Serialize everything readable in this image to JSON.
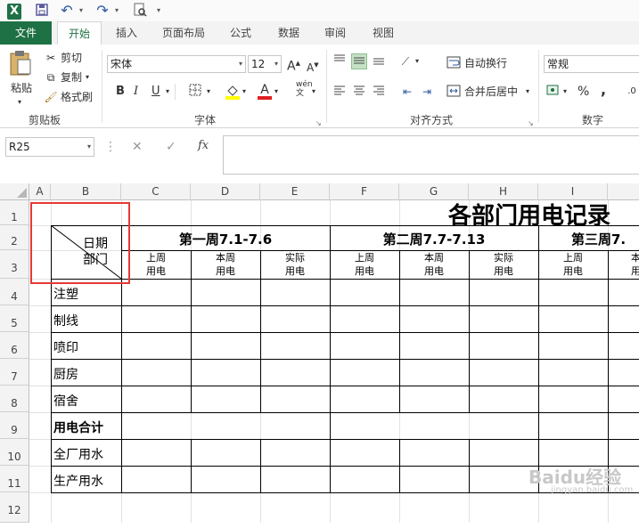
{
  "qat": {
    "logo": "X",
    "save_icon": "save-icon",
    "undo_icon": "undo-icon",
    "redo_icon": "redo-icon",
    "preview_icon": "print-preview-icon",
    "customize": "▾"
  },
  "tabs": [
    "文件",
    "开始",
    "插入",
    "页面布局",
    "公式",
    "数据",
    "审阅",
    "视图"
  ],
  "ribbon": {
    "clipboard": {
      "paste": "粘贴",
      "cut": "剪切",
      "copy": "复制",
      "format_painter": "格式刷",
      "label": "剪贴板"
    },
    "font": {
      "name": "宋体",
      "size": "12",
      "grow": "A",
      "shrink": "A",
      "bold": "B",
      "italic": "I",
      "underline": "U",
      "wen": "wén",
      "label": "字体"
    },
    "alignment": {
      "wrap": "自动换行",
      "merge": "合并后居中",
      "label": "对齐方式"
    },
    "number": {
      "format": "常规",
      "percent": "%",
      "comma": ",",
      "label": "数字"
    }
  },
  "formula_bar": {
    "name_box": "R25",
    "fx": "fx",
    "cancel": "✕",
    "enter": "✓",
    "value": ""
  },
  "columns": [
    "A",
    "B",
    "C",
    "D",
    "E",
    "F",
    "G",
    "H",
    "I"
  ],
  "rows": [
    "1",
    "2",
    "3",
    "4",
    "5",
    "6",
    "7",
    "8",
    "9",
    "10",
    "11",
    "12"
  ],
  "sheet": {
    "title": "各部门用电记录",
    "diag_top": "日期",
    "diag_bottom": "部门",
    "week1": "第一周7.1-7.6",
    "week2": "第二周7.7-7.13",
    "week3": "第三周7.",
    "sub_c": "上周\n用电",
    "sub_d": "本周\n用电",
    "sub_e": "实际\n用电",
    "sub_f": "上周\n用电",
    "sub_g": "本周\n用电",
    "sub_h": "实际\n用电",
    "sub_i": "上周\n用电",
    "sub_j": "本",
    "sub_j2": "用",
    "dept": [
      "注塑",
      "制线",
      "喷印",
      "厨房",
      "宿舍"
    ],
    "total": "用电合计",
    "water_all": "全厂用水",
    "water_prod": "生产用水"
  },
  "watermark": {
    "brand": "Baidu经验",
    "url": "jingyan.baidu.com"
  },
  "accent": "#1e7145",
  "highlight_box_color": "#e53935"
}
